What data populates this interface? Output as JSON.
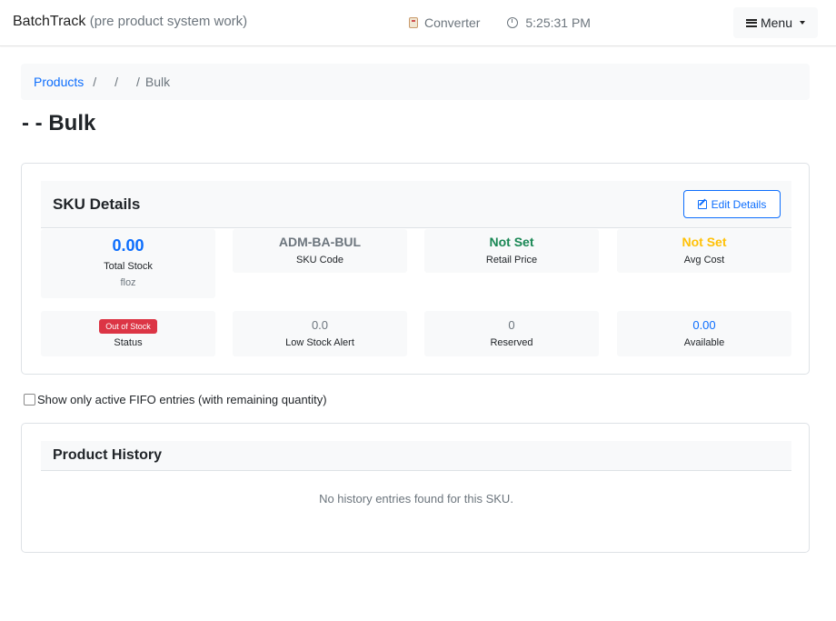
{
  "navbar": {
    "brand": "BatchTrack",
    "brand_sub": "(pre product system work)",
    "converter_label": "Converter",
    "time": "5:25:31 PM",
    "menu_label": "Menu"
  },
  "breadcrumb": {
    "products": "Products",
    "sep1": "/",
    "sep2": "/",
    "sep3": "/",
    "current": "Bulk"
  },
  "page_title": "- - Bulk",
  "sku_details": {
    "title": "SKU Details",
    "edit_label": "Edit Details",
    "total_stock": {
      "value": "0.00",
      "label": "Total Stock",
      "unit": "floz"
    },
    "sku_code": {
      "value": "ADM-BA-BUL",
      "label": "SKU Code"
    },
    "retail_price": {
      "value": "Not Set",
      "label": "Retail Price"
    },
    "avg_cost": {
      "value": "Not Set",
      "label": "Avg Cost"
    },
    "status": {
      "badge": "Out of Stock",
      "label": "Status"
    },
    "low_stock": {
      "value": "0.0",
      "label": "Low Stock Alert"
    },
    "reserved": {
      "value": "0",
      "label": "Reserved"
    },
    "available": {
      "value": "0.00",
      "label": "Available"
    }
  },
  "fifo_filter": {
    "label": "Show only active FIFO entries (with remaining quantity)",
    "checked": false
  },
  "history": {
    "title": "Product History",
    "empty_message": "No history entries found for this SKU."
  },
  "colors": {
    "primary": "#0d6efd",
    "success": "#198754",
    "warning": "#ffc107",
    "danger": "#dc3545"
  }
}
